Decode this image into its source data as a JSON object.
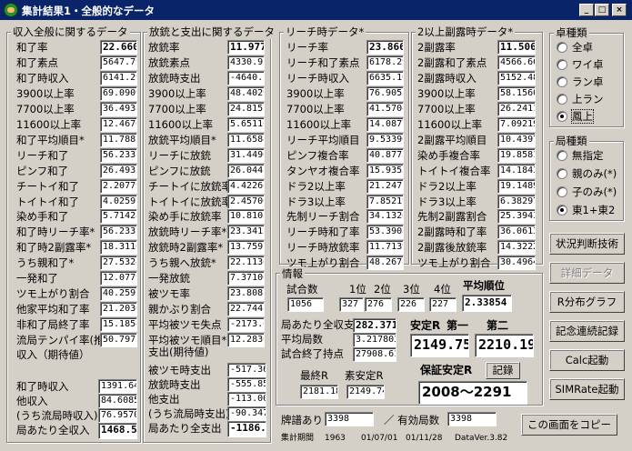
{
  "window": {
    "title": "集計結果1・全般的なデータ",
    "min": "_",
    "max": "□",
    "close": "×"
  },
  "g1": {
    "title": "収入全般に関するデータ",
    "labels": [
      "和了率",
      "和了素点",
      "和了時収入",
      "3900以上率",
      "7700以上率",
      "11600以上率",
      "和了平均順目*",
      "リーチ和了",
      "ピンフ和了",
      "チートイ和了",
      "トイトイ和了",
      "染め手和了",
      "和了時リーチ率*",
      "和了時2副露率*",
      "うち親和了*",
      "一発和了",
      "ツモ上がり割合",
      "他家平均和了率",
      "非和了局終了率",
      "流局テンパイ率(推)"
    ],
    "values": [
      "22.660",
      "5647.79",
      "6141.29",
      "69.0909",
      "36.4938",
      "12.4676",
      "11.7883",
      "56.2337",
      "26.4935",
      "2.20779",
      "4.02597",
      "5.71428",
      "56.2337",
      "18.3116",
      "27.5324",
      "12.0779",
      "40.2597",
      "21.2036",
      "15.1854",
      "50.7972"
    ],
    "income_title": "収入（期待値）",
    "income_labels": [
      "和了時収入",
      "他収入",
      "(うち流局時収入)",
      "局あたり全収入"
    ],
    "income_values": [
      "1391.64",
      "84.6085",
      "76.9570",
      "1468.59"
    ]
  },
  "g2": {
    "title": "放銃と支出に関するデータ",
    "labels": [
      "放銃率",
      "放銃素点",
      "放銃時支出",
      "3900以上率",
      "7700以上率",
      "11600以上率",
      "放銃平均順目*",
      "リーチに放銃",
      "ピンフに放銃",
      "チートイに放銃率",
      "トイトイに放銃率",
      "染め手に放銃率",
      "放銃時リーチ率*",
      "放銃時2副露率*",
      "うち親へ放銃*",
      "一発放銃",
      "被ツモ率",
      "親かぶり割合",
      "平均被ツモ失点",
      "平均被ツモ順目*"
    ],
    "values": [
      "11.977",
      "4330.95",
      "-4640.7",
      "48.4029",
      "24.8157",
      "5.65110",
      "11.6584",
      "31.4496",
      "26.0442",
      "4.42260",
      "2.45700",
      "10.8108",
      "23.3415",
      "13.7592",
      "22.1130",
      "7.37100",
      "23.8081",
      "22.7441",
      "-2173.0",
      "12.2830"
    ],
    "expense_title": "支出(期待値)",
    "expense_labels": [
      "被ツモ時支出",
      "放銃時支出",
      "他支出",
      "(うち流局時支出)",
      "局あたり全支出"
    ],
    "expense_values": [
      "-517.36",
      "-555.85",
      "-113.00",
      "-90.347",
      "-1186.2"
    ]
  },
  "g3": {
    "title": "リーチ時データ*",
    "labels": [
      "リーチ率",
      "リーチ和了素点",
      "リーチ時収入",
      "3900以上率",
      "7700以上率",
      "11600以上率",
      "リーチ平均順目",
      "ピンフ複合率",
      "タンヤオ複合率",
      "ドラ2以上率",
      "ドラ3以上率",
      "先制リーチ割合",
      "リーチ時和了率",
      "リーチ時放銃率",
      "ツモ上がり割合"
    ],
    "values": [
      "23.866",
      "6178.29",
      "6635.10",
      "76.9053",
      "41.5704",
      "14.0877",
      "9.53390",
      "40.8775",
      "15.9353",
      "21.2471",
      "7.85219",
      "34.1320",
      "53.3908",
      "11.7139",
      "48.2678"
    ]
  },
  "g4": {
    "title": "2以上副露時データ*",
    "labels": [
      "2副露率",
      "2副露和了素点",
      "2副露時収入",
      "3900以上率",
      "7700以上率",
      "11600以上率",
      "2副露平均順目",
      "染め手複合率",
      "トイトイ複合率",
      "ドラ2以上率",
      "ドラ3以上率",
      "先制2副露割合",
      "2副露時和了率",
      "2副露後放銃率",
      "ツモ上がり割合"
    ],
    "values": [
      "11.506",
      "4566.66",
      "5152.48",
      "58.1560",
      "26.2411",
      "7.09219",
      "10.4397",
      "19.8581",
      "14.1843",
      "19.1489",
      "6.38297",
      "25.3943",
      "36.0613",
      "14.3222",
      "30.4964"
    ]
  },
  "info": {
    "title": "情報",
    "games_label": "試合数",
    "games": "1056",
    "rank_labels": [
      "1位",
      "2位",
      "3位",
      "4位"
    ],
    "rank_values": [
      "327",
      "276",
      "226",
      "227"
    ],
    "avg_rank_label": "平均順位",
    "avg_rank": "2.33854",
    "per_hand_label": "局あたり全収支",
    "per_hand": "282.371",
    "avg_hands_label": "平均局数",
    "avg_hands": "3.217803",
    "end_points_label": "試合終了持点",
    "end_points": "27908.61",
    "stable_r_label": "安定R",
    "first_label": "第一",
    "second_label": "第二",
    "stable_r_first": "2149.75",
    "stable_r_second": "2210.19",
    "last_r_label": "最終R",
    "last_r": "2181.18",
    "pure_stable_r_label": "素安定R",
    "pure_stable_r": "2149.74",
    "guaranteed_label": "保証安定R",
    "record_btn": "記錄",
    "guaranteed": "2008〜2291"
  },
  "footer": {
    "logs_label": "牌譜あり",
    "logs": "3398",
    "valid_label": "／ 有効局数",
    "valid": "3398",
    "period_label": "集計期間",
    "count": "1963",
    "date_from": "01/07/01",
    "date_to": "01/11/28",
    "version": "DataVer.3.82"
  },
  "table_type": {
    "title": "卓種類",
    "options": [
      "全卓",
      "ワイ卓",
      "ラン卓",
      "上ラン",
      "鳳上"
    ],
    "selected": 4
  },
  "round_type": {
    "title": "局種類",
    "options": [
      "無指定",
      "親のみ(*)",
      "子のみ(*)",
      "東1+東2"
    ],
    "selected": 3
  },
  "buttons": {
    "situation": "状況判断技術",
    "detail": "詳細データ",
    "rdist": "R分布グラフ",
    "memorial": "記念連続記録",
    "calc": "Calc起動",
    "simrate": "SIMRate起動",
    "copy": "この画面をコピー"
  }
}
